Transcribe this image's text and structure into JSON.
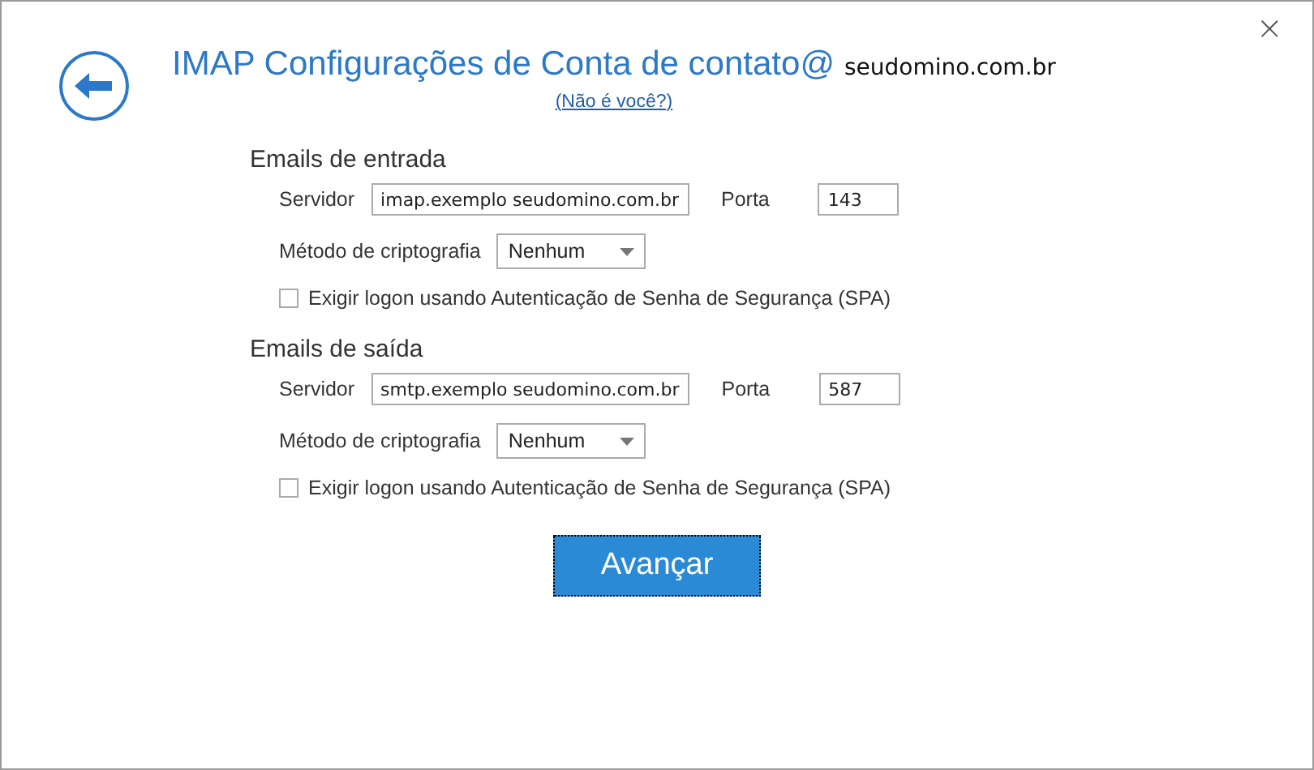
{
  "window": {
    "close": "×"
  },
  "header": {
    "title": "IMAP Configurações de Conta de contato@",
    "title_domain": "seudomino.com.br",
    "link": "(Não é você?)"
  },
  "sections": [
    {
      "heading": "Emails de entrada",
      "server_label": "Servidor",
      "server": "imap.exemplo seudomino.com.br",
      "port_label": "Porta",
      "port": "143",
      "encryption_label": "Método de criptografia",
      "encryption": "Nenhum",
      "spa_label": "Exigir logon usando Autenticação de Senha de Segurança (SPA)",
      "spa_checked": false
    },
    {
      "heading": "Emails de saída",
      "server_label": "Servidor",
      "server": "smtp.exemplo seudomino.com.br",
      "port_label": "Porta",
      "port": "587",
      "encryption_label": "Método de criptografia",
      "encryption": "Nenhum",
      "spa_label": "Exigir logon usando Autenticação de Senha de Segurança (SPA)",
      "spa_checked": false
    }
  ],
  "next_button": "Avançar"
}
